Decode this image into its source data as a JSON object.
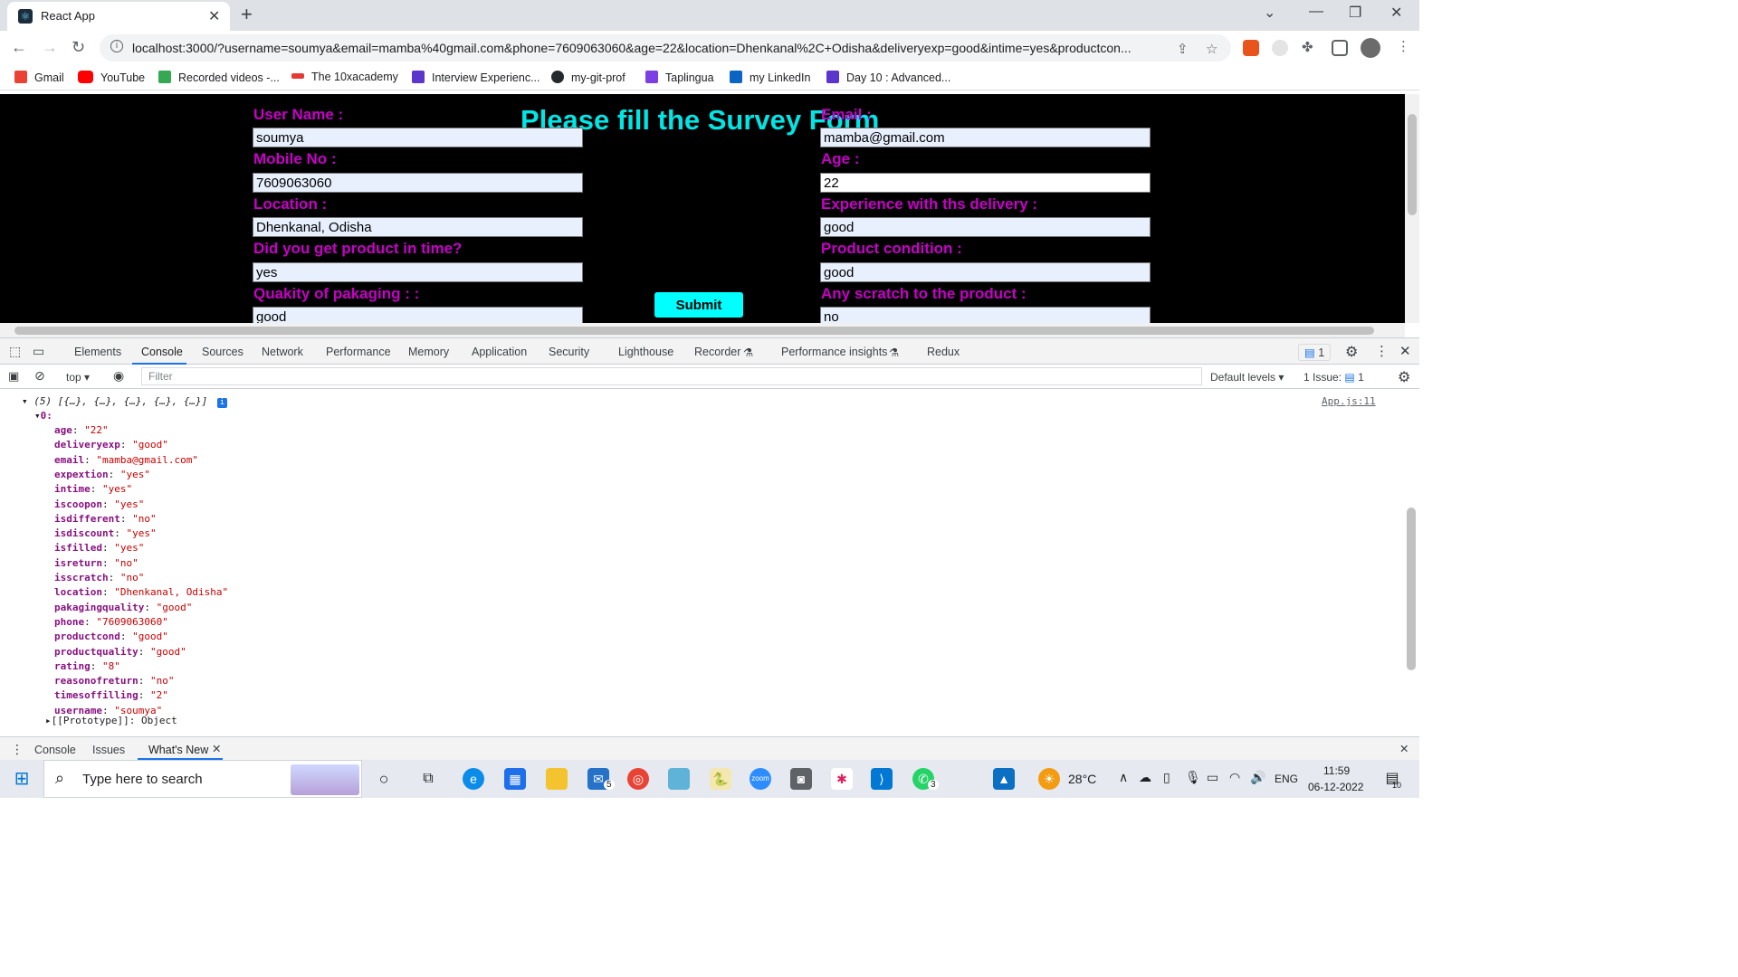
{
  "browser": {
    "tab_title": "React App",
    "url": "localhost:3000/?username=soumya&email=mamba%40gmail.com&phone=7609063060&age=22&location=Dhenkanal%2C+Odisha&deliveryexp=good&intime=yes&productcon...",
    "bookmarks": [
      "Gmail",
      "YouTube",
      "Recorded videos -...",
      "The 10xacademy",
      "Interview Experienc...",
      "my-git-prof",
      "Taplingua",
      "my LinkedIn",
      "Day 10 : Advanced..."
    ]
  },
  "page": {
    "title": "Please fill the Survey Form",
    "fields": {
      "username": {
        "label": "User Name :",
        "value": "soumya"
      },
      "email": {
        "label": "Email :",
        "value": "mamba@gmail.com"
      },
      "phone": {
        "label": "Mobile No :",
        "value": "7609063060"
      },
      "age": {
        "label": "Age :",
        "value": "22"
      },
      "location": {
        "label": "Location :",
        "value": "Dhenkanal, Odisha"
      },
      "deliveryexp": {
        "label": "Experience with ths delivery :",
        "value": "good"
      },
      "intime": {
        "label": "Did you get product in time?",
        "value": "yes"
      },
      "productcond": {
        "label": "Product condition :",
        "value": "good"
      },
      "packaging": {
        "label": "Quakity of pakaging : :",
        "value": "good"
      },
      "scratch": {
        "label": "Any scratch to the product :",
        "value": "no"
      }
    },
    "submit_label": "Submit"
  },
  "devtools": {
    "tabs": [
      "Elements",
      "Console",
      "Sources",
      "Network",
      "Performance",
      "Memory",
      "Application",
      "Security",
      "Lighthouse",
      "Recorder",
      "Performance insights",
      "Redux"
    ],
    "issues_badge": "1",
    "context": "top",
    "filter_placeholder": "Filter",
    "levels": "Default levels",
    "issues_count": "1 Issue:",
    "issues_count_num": "1",
    "log_header": "(5) [{…}, {…}, {…}, {…}, {…}]",
    "log_source": "App.js:11",
    "index0": "0:",
    "entries": [
      {
        "key": "age",
        "value": "\"22\""
      },
      {
        "key": "deliveryexp",
        "value": "\"good\""
      },
      {
        "key": "email",
        "value": "\"mamba@gmail.com\""
      },
      {
        "key": "expextion",
        "value": "\"yes\""
      },
      {
        "key": "intime",
        "value": "\"yes\""
      },
      {
        "key": "iscoopon",
        "value": "\"yes\""
      },
      {
        "key": "isdifferent",
        "value": "\"no\""
      },
      {
        "key": "isdiscount",
        "value": "\"yes\""
      },
      {
        "key": "isfilled",
        "value": "\"yes\""
      },
      {
        "key": "isreturn",
        "value": "\"no\""
      },
      {
        "key": "isscratch",
        "value": "\"no\""
      },
      {
        "key": "location",
        "value": "\"Dhenkanal, Odisha\""
      },
      {
        "key": "pakagingquality",
        "value": "\"good\""
      },
      {
        "key": "phone",
        "value": "\"7609063060\""
      },
      {
        "key": "productcond",
        "value": "\"good\""
      },
      {
        "key": "productquality",
        "value": "\"good\""
      },
      {
        "key": "rating",
        "value": "\"8\""
      },
      {
        "key": "reasonofreturn",
        "value": "\"no\""
      },
      {
        "key": "timesoffilling",
        "value": "\"2\""
      },
      {
        "key": "username",
        "value": "\"soumya\""
      }
    ],
    "prototype": "[[Prototype]]: Object",
    "drawer_tabs": [
      "Console",
      "Issues",
      "What's New"
    ]
  },
  "taskbar": {
    "search_placeholder": "Type here to search",
    "weather": "28°C",
    "language": "ENG",
    "time": "11:59",
    "date": "06-12-2022",
    "mail_badge": "5",
    "whatsapp_badge": "3",
    "notification_count": "10"
  }
}
